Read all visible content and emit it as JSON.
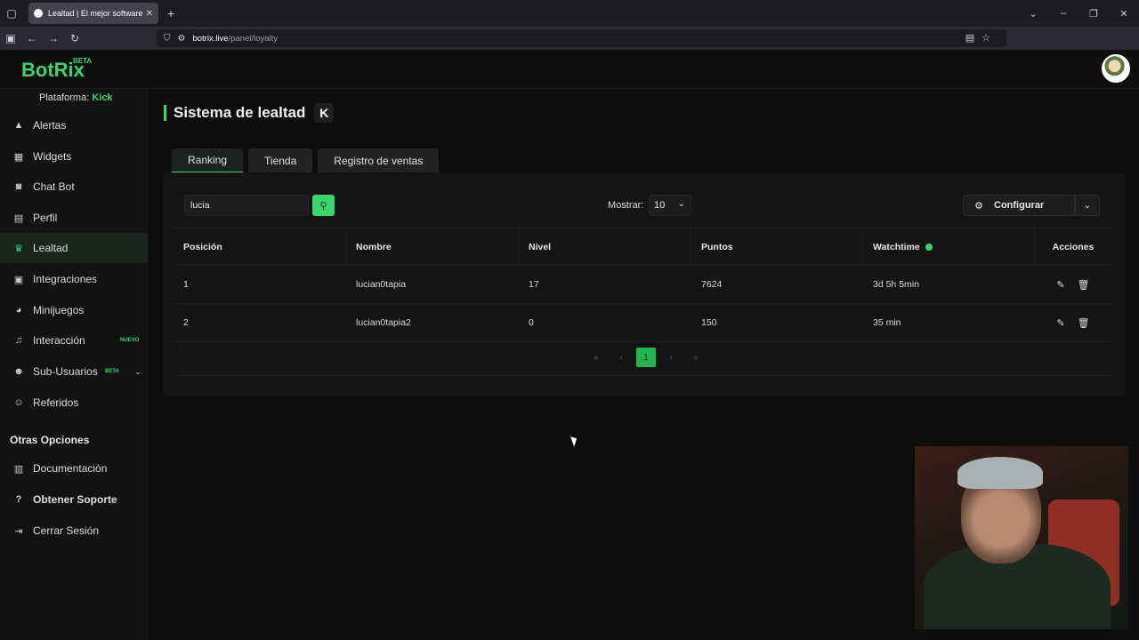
{
  "browser": {
    "tab_title": "Lealtad | El mejor software para",
    "url_host": "botrix.live",
    "url_path": "/panel/loyalty"
  },
  "app": {
    "logo": "BotRix",
    "logo_badge": "BETA",
    "platform_label": "Plataforma:",
    "platform_value": "Kick"
  },
  "sidebar": {
    "items": [
      {
        "label": "Alertas",
        "icon": "warning-icon"
      },
      {
        "label": "Widgets",
        "icon": "grid-icon"
      },
      {
        "label": "Chat Bot",
        "icon": "robot-icon"
      },
      {
        "label": "Perfil",
        "icon": "id-card-icon"
      },
      {
        "label": "Lealtad",
        "icon": "trophy-icon",
        "active": true
      },
      {
        "label": "Integraciones",
        "icon": "plug-icon"
      },
      {
        "label": "Minijuegos",
        "icon": "gamepad-icon"
      },
      {
        "label": "Interacción",
        "icon": "music-icon",
        "badge": "NUEVO"
      },
      {
        "label": "Sub-Usuarios",
        "icon": "users-icon",
        "badge": "BETA"
      },
      {
        "label": "Referidos",
        "icon": "user-friends-icon"
      }
    ],
    "other_title": "Otras Opciones",
    "other_items": [
      {
        "label": "Documentación",
        "icon": "book-icon"
      },
      {
        "label": "Obtener Soporte",
        "icon": "question-icon"
      },
      {
        "label": "Cerrar Sesión",
        "icon": "logout-icon"
      }
    ],
    "accent": "#3ad56c"
  },
  "page": {
    "title": "Sistema de lealtad",
    "tabs": [
      "Ranking",
      "Tienda",
      "Registro de ventas"
    ],
    "active_tab": "Ranking"
  },
  "controls": {
    "search_value": "lucia",
    "show_label": "Mostrar:",
    "show_value": "10",
    "config_label": "Configurar"
  },
  "table": {
    "headers": [
      "Posición",
      "Nombre",
      "Nivel",
      "Puntos",
      "Watchtime",
      "Acciones"
    ],
    "rows": [
      {
        "pos": "1",
        "name": "lucian0tapia",
        "level": "17",
        "points": "7624",
        "watchtime": "3d 5h 5min"
      },
      {
        "pos": "2",
        "name": "lucian0tapia2",
        "level": "0",
        "points": "150",
        "watchtime": "35 min"
      }
    ]
  },
  "pagination": {
    "current": "1"
  }
}
